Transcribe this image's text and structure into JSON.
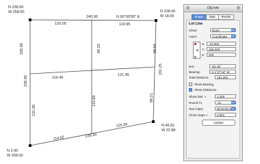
{
  "corners": {
    "top_left": {
      "north": "N 238.00",
      "west": "W 258.00"
    },
    "top_right": {
      "north": "N 238.00",
      "west": "W 18.00"
    },
    "bottom_right": {
      "north": "N 46.81",
      "west": "W 22.88"
    },
    "bottom_left": {
      "north": "N 2.00",
      "west": "W 258.00"
    }
  },
  "dims": {
    "top_mid": "240.00",
    "bearing_top": "N 90°00'00\" E",
    "top_seg1": "120.05",
    "top_seg2": "119.95",
    "left_upper": "105.00",
    "left_mid": "236.00",
    "left_lower": "131.00",
    "center_upper": "99.29",
    "center_lower": "115.60",
    "right_upper": "99.04",
    "right_lower": "98.21",
    "right_total": "191.25",
    "mid_left": "116.49",
    "mid_right": "121.45",
    "bottom_seg1": "114.02",
    "bottom_seg2": "125.34",
    "bottom_total": "238.35"
  },
  "panel": {
    "title": "Obj Info",
    "tabs": [
      "Shape",
      "Data",
      "Render"
    ],
    "heading": "Lot Line",
    "class_label": "Class:",
    "class_value": "None",
    "layer_label": "Layer:",
    "layer_value": "Coordinate",
    "x_label": "X:",
    "x_value": "-10.000",
    "y_label": "Y:",
    "y_value": "258.000",
    "z_label": "Z:",
    "z_value": "000",
    "rot_label": "Rot:",
    "rot_value": "-91.46°",
    "bearing_label": "Bearing:",
    "bearing_value": "S 1°27'44\" W",
    "total_label": "Total Distance:",
    "total_value": "191.251",
    "show_bearing": "Show Bearing",
    "show_distances": "Show Distances",
    "show_dist_label": "Show Dist. >",
    "show_dist_value": "1.000",
    "round_label": "Round To",
    "round_value": ".01",
    "text_class_label": "Text Class",
    "text_class_value": "Dimension",
    "close_gaps_label": "Close Gaps <",
    "close_gaps_value": "0.001",
    "update_label": "Update"
  }
}
